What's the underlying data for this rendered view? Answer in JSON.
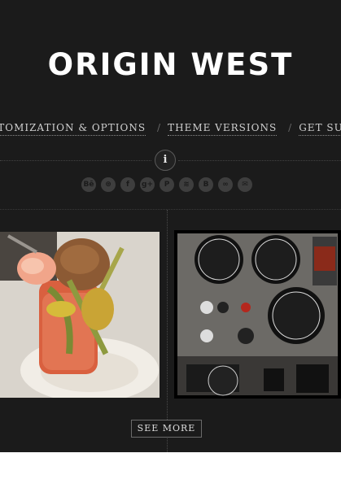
{
  "site": {
    "title": "ORIGIN WEST"
  },
  "nav": {
    "items": [
      {
        "label": "STOMIZATION & OPTIONS"
      },
      {
        "label": "THEME VERSIONS"
      },
      {
        "label": "GET SU"
      }
    ],
    "separator": "/"
  },
  "info_button": {
    "label": "i"
  },
  "social": {
    "icons": [
      {
        "name": "behance-icon",
        "glyph": "Bē"
      },
      {
        "name": "dribbble-icon",
        "glyph": "⊛"
      },
      {
        "name": "facebook-icon",
        "glyph": "f"
      },
      {
        "name": "google-plus-icon",
        "glyph": "g+"
      },
      {
        "name": "pinterest-icon",
        "glyph": "P"
      },
      {
        "name": "spotify-icon",
        "glyph": "≋"
      },
      {
        "name": "blogger-icon",
        "glyph": "B"
      },
      {
        "name": "link-icon",
        "glyph": "∞"
      },
      {
        "name": "email-icon",
        "glyph": "✉"
      }
    ]
  },
  "gallery": {
    "photos": [
      {
        "name": "photo-bloody-mary"
      },
      {
        "name": "photo-cockpit-gauges"
      }
    ],
    "see_more_label": "SEE MORE"
  },
  "colors": {
    "background": "#1b1b1b",
    "text": "#ffffff",
    "muted": "#d0d0d0"
  }
}
